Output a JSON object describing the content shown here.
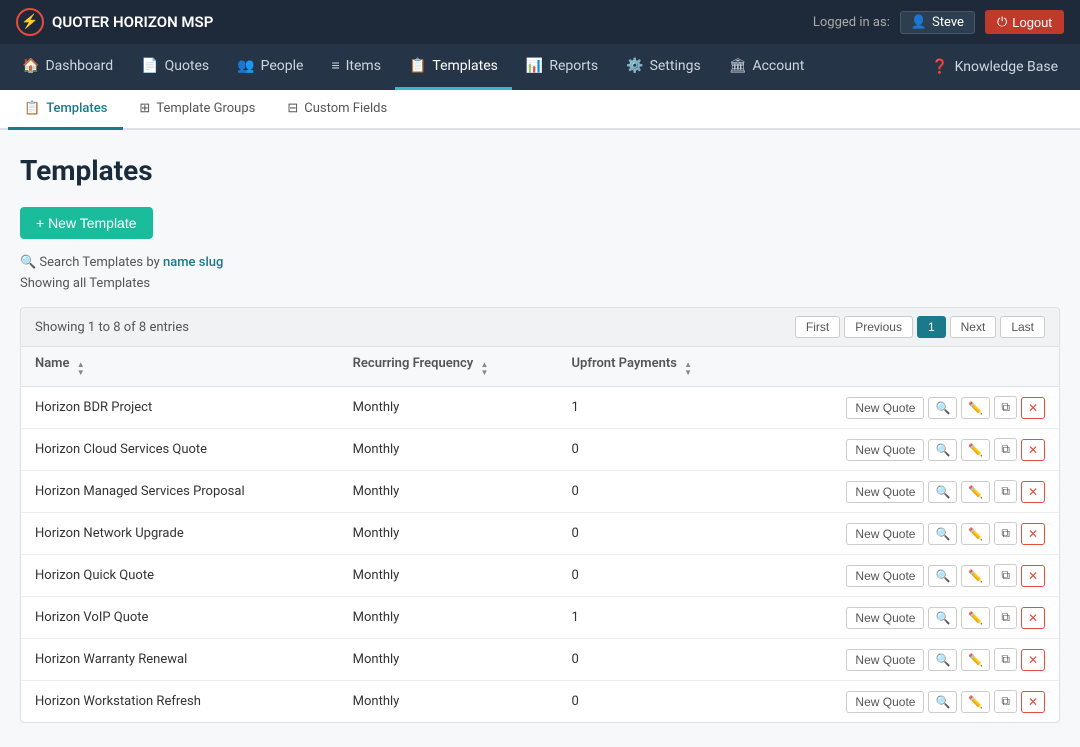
{
  "brand": {
    "name": "QUOTER HORIZON MSP",
    "icon": "⚡"
  },
  "topbar": {
    "logged_in_as": "Logged in as:",
    "user": "Steve",
    "logout_label": "Logout"
  },
  "nav": {
    "items": [
      {
        "id": "dashboard",
        "label": "Dashboard",
        "icon": "🏠",
        "active": false
      },
      {
        "id": "quotes",
        "label": "Quotes",
        "icon": "📄",
        "active": false
      },
      {
        "id": "people",
        "label": "People",
        "icon": "👥",
        "active": false
      },
      {
        "id": "items",
        "label": "Items",
        "icon": "≡",
        "active": false
      },
      {
        "id": "templates",
        "label": "Templates",
        "icon": "📋",
        "active": true
      },
      {
        "id": "reports",
        "label": "Reports",
        "icon": "📊",
        "active": false
      },
      {
        "id": "settings",
        "label": "Settings",
        "icon": "⚙️",
        "active": false
      },
      {
        "id": "account",
        "label": "Account",
        "icon": "🏛",
        "active": false
      }
    ],
    "knowledge_base": "Knowledge Base"
  },
  "subnav": {
    "items": [
      {
        "id": "templates",
        "label": "Templates",
        "icon": "📋",
        "active": true
      },
      {
        "id": "template-groups",
        "label": "Template Groups",
        "icon": "⊞",
        "active": false
      },
      {
        "id": "custom-fields",
        "label": "Custom Fields",
        "icon": "⊟",
        "active": false
      }
    ]
  },
  "page": {
    "title": "Templates",
    "new_template_label": "+ New Template",
    "search_prefix": "Search Templates by",
    "search_name": "name",
    "search_slug": "slug",
    "showing_all": "Showing all Templates"
  },
  "table": {
    "header": {
      "showing": "Showing 1 to 8 of 8 entries",
      "pagination": {
        "first": "First",
        "previous": "Previous",
        "page": "1",
        "next": "Next",
        "last": "Last"
      }
    },
    "columns": [
      {
        "id": "name",
        "label": "Name",
        "sortable": true
      },
      {
        "id": "recurring_frequency",
        "label": "Recurring Frequency",
        "sortable": true
      },
      {
        "id": "upfront_payments",
        "label": "Upfront Payments",
        "sortable": true
      }
    ],
    "rows": [
      {
        "name": "Horizon BDR Project",
        "recurring_frequency": "Monthly",
        "upfront_payments": "1"
      },
      {
        "name": "Horizon Cloud Services Quote",
        "recurring_frequency": "Monthly",
        "upfront_payments": "0"
      },
      {
        "name": "Horizon Managed Services Proposal",
        "recurring_frequency": "Monthly",
        "upfront_payments": "0"
      },
      {
        "name": "Horizon Network Upgrade",
        "recurring_frequency": "Monthly",
        "upfront_payments": "0"
      },
      {
        "name": "Horizon Quick Quote",
        "recurring_frequency": "Monthly",
        "upfront_payments": "0"
      },
      {
        "name": "Horizon VoIP Quote",
        "recurring_frequency": "Monthly",
        "upfront_payments": "1"
      },
      {
        "name": "Horizon Warranty Renewal",
        "recurring_frequency": "Monthly",
        "upfront_payments": "0"
      },
      {
        "name": "Horizon Workstation Refresh",
        "recurring_frequency": "Monthly",
        "upfront_payments": "0"
      }
    ],
    "actions": {
      "new_quote": "New Quote"
    }
  }
}
